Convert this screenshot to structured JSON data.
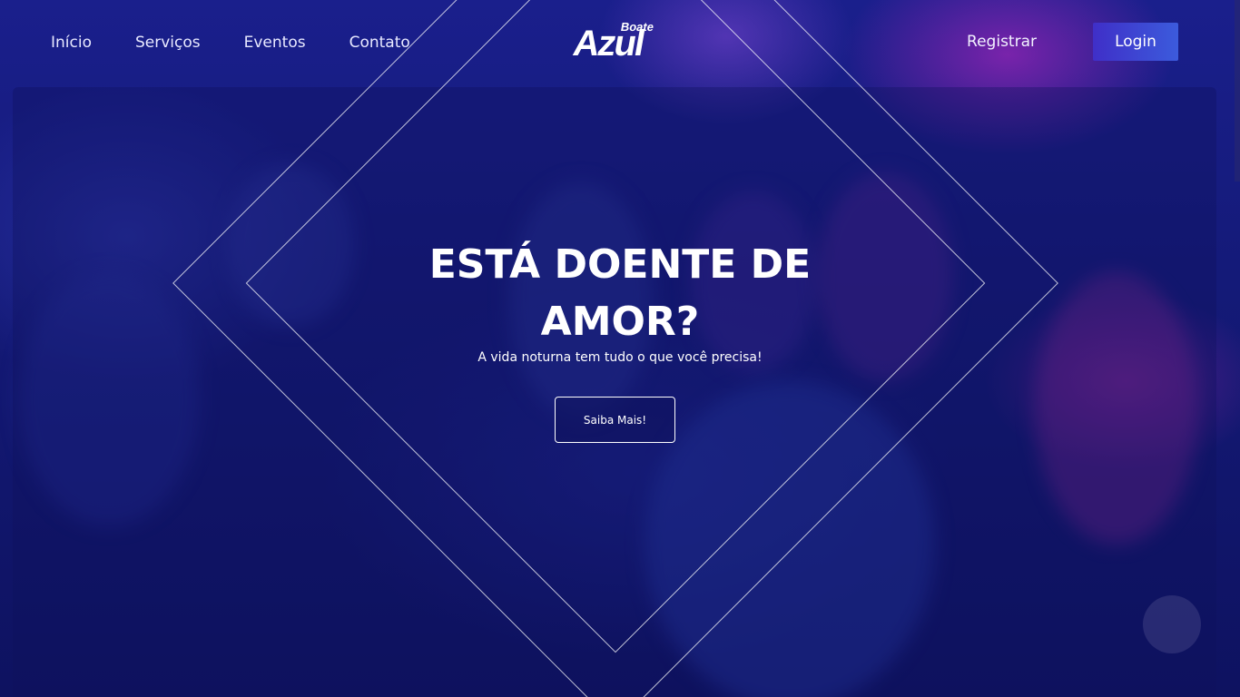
{
  "nav": {
    "links": [
      "Início",
      "Serviços",
      "Eventos",
      "Contato"
    ],
    "register_label": "Registrar",
    "login_label": "Login"
  },
  "logo": {
    "small": "Boate",
    "big": "Azul"
  },
  "hero": {
    "title": "ESTÁ DOENTE DE AMOR?",
    "subtitle": "A vida noturna tem tudo o que você precisa!",
    "cta_label": "Saiba Mais!"
  },
  "colors": {
    "background": "#141a78",
    "login_button_start": "#3f2fc8",
    "login_button_end": "#3c5bdc",
    "text": "#ffffff"
  }
}
